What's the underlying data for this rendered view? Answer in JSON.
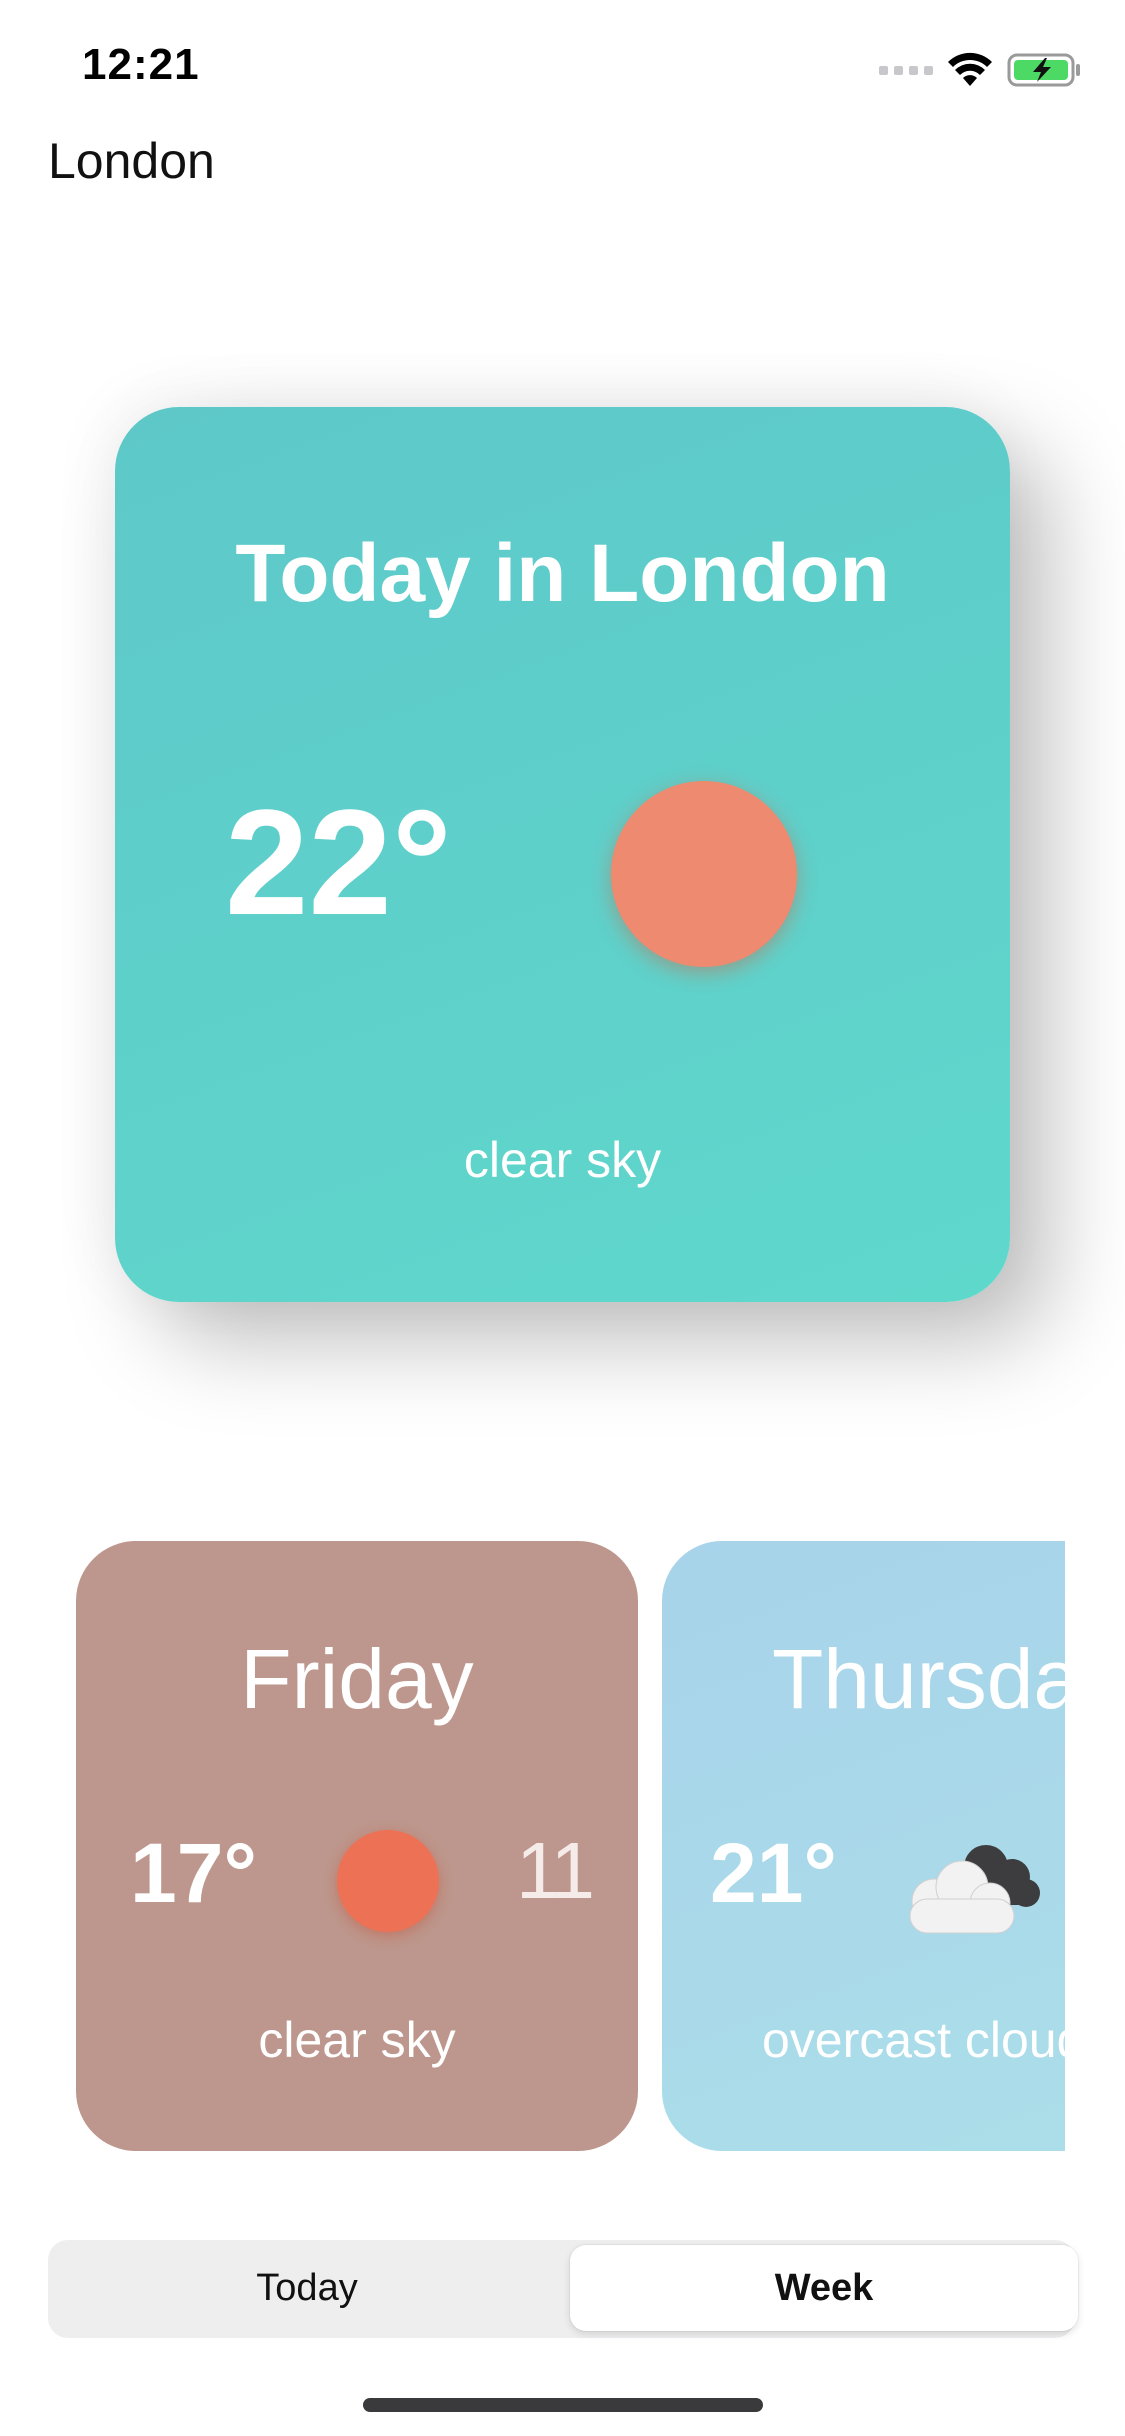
{
  "status_bar": {
    "time": "12:21",
    "icons": [
      "cellular-signal-icon",
      "wifi-icon",
      "battery-charging-icon"
    ],
    "battery_color": "#4cd964"
  },
  "nav": {
    "title": "London"
  },
  "today_card": {
    "title": "Today in London",
    "temperature": "22°",
    "description": "clear sky",
    "icon": "sun-icon",
    "background_color": "#5fcfcb",
    "icon_color": "#ee8a70"
  },
  "week_cards": [
    {
      "day": "Friday",
      "temperature": "17°",
      "extra": "11",
      "description": "clear sky",
      "icon": "sun-icon",
      "background_color": "#bd978d",
      "icon_color": "#ec7155"
    },
    {
      "day": "Thursday",
      "temperature": "21°",
      "description": "overcast clouds",
      "icon": "overcast-clouds-icon",
      "background_color": "#aad8e9"
    }
  ],
  "segmented_control": {
    "options": [
      "Today",
      "Week"
    ],
    "selected": "Week"
  }
}
